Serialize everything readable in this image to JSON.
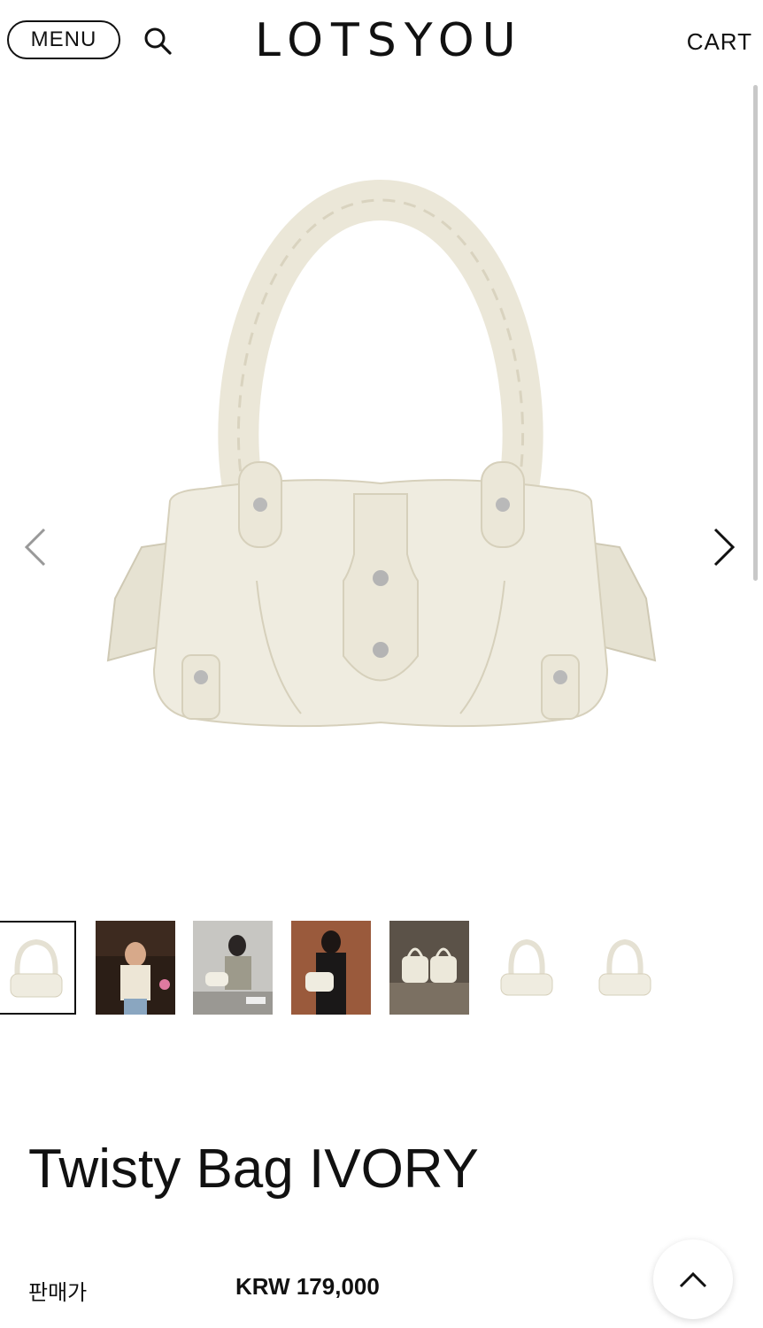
{
  "header": {
    "menu_label": "MENU",
    "logo": "LOTSYOU",
    "cart_label": "CART",
    "search_icon": "search-icon"
  },
  "gallery": {
    "prev_icon": "chevron-left-icon",
    "next_icon": "chevron-right-icon",
    "thumbnails": [
      {
        "name": "thumb-product-1",
        "active": true
      },
      {
        "name": "thumb-model-1",
        "active": false
      },
      {
        "name": "thumb-model-2",
        "active": false
      },
      {
        "name": "thumb-model-3",
        "active": false
      },
      {
        "name": "thumb-lifestyle",
        "active": false
      },
      {
        "name": "thumb-product-2",
        "active": false
      },
      {
        "name": "thumb-product-3",
        "active": false
      }
    ]
  },
  "product": {
    "title": "Twisty Bag IVORY",
    "price_label": "판매가",
    "price_value": "KRW 179,000"
  },
  "colors": {
    "bag": "#efece0",
    "bag_shade": "#ddd8c6",
    "text": "#111111"
  },
  "scroll_top_icon": "chevron-up-icon"
}
